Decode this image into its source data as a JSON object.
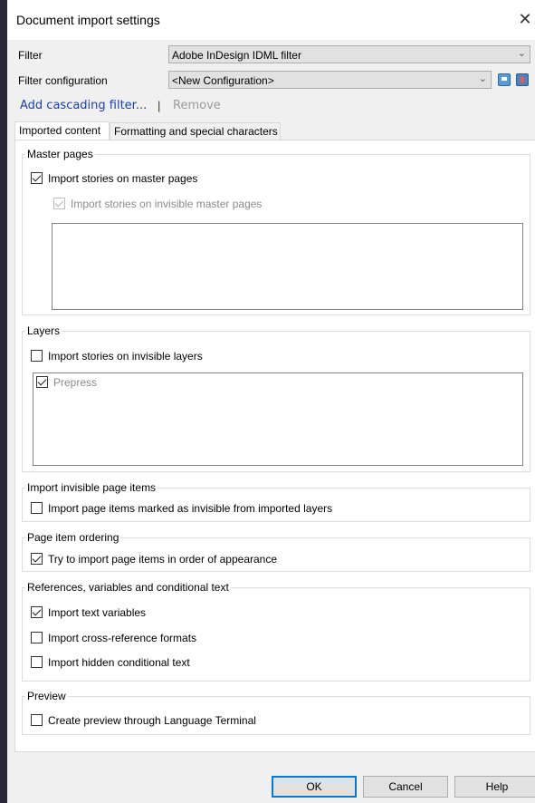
{
  "window": {
    "title": "Document import settings",
    "close_glyph": "✕"
  },
  "filter": {
    "label": "Filter",
    "value": "Adobe InDesign IDML filter"
  },
  "filter_config": {
    "label": "Filter configuration",
    "value": "<New Configuration>"
  },
  "links": {
    "add_cascading": "Add cascading filter...",
    "separator": "|",
    "remove": "Remove"
  },
  "tabs": [
    {
      "label": "Imported content",
      "active": true
    },
    {
      "label": "Formatting and special characters",
      "active": false
    }
  ],
  "master_pages": {
    "title": "Master pages",
    "import_stories": {
      "label": "Import stories on master pages",
      "checked": true
    },
    "import_invisible": {
      "label": "Import stories on invisible master pages",
      "checked": true,
      "disabled": true
    }
  },
  "layers": {
    "title": "Layers",
    "import_invisible": {
      "label": "Import stories on invisible layers",
      "checked": false
    },
    "items": [
      {
        "label": "Prepress",
        "checked": true
      }
    ]
  },
  "invisible_items": {
    "title": "Import invisible page items",
    "option": {
      "label": "Import page items marked as invisible from imported layers",
      "checked": false
    }
  },
  "ordering": {
    "title": "Page item ordering",
    "option": {
      "label": "Try to import page items in order of appearance",
      "checked": true
    }
  },
  "references": {
    "title": "References, variables and conditional text",
    "text_variables": {
      "label": "Import text variables",
      "checked": true
    },
    "xref_formats": {
      "label": "Import cross-reference formats",
      "checked": false
    },
    "hidden_conditional": {
      "label": "Import hidden conditional text",
      "checked": false
    }
  },
  "preview": {
    "title": "Preview",
    "option": {
      "label": "Create preview through Language Terminal",
      "checked": false
    }
  },
  "buttons": {
    "ok": "OK",
    "cancel": "Cancel",
    "help": "Help"
  },
  "colors": {
    "link": "#1a3fb0",
    "accent": "#0078d7",
    "backdrop": "#2b2937"
  }
}
